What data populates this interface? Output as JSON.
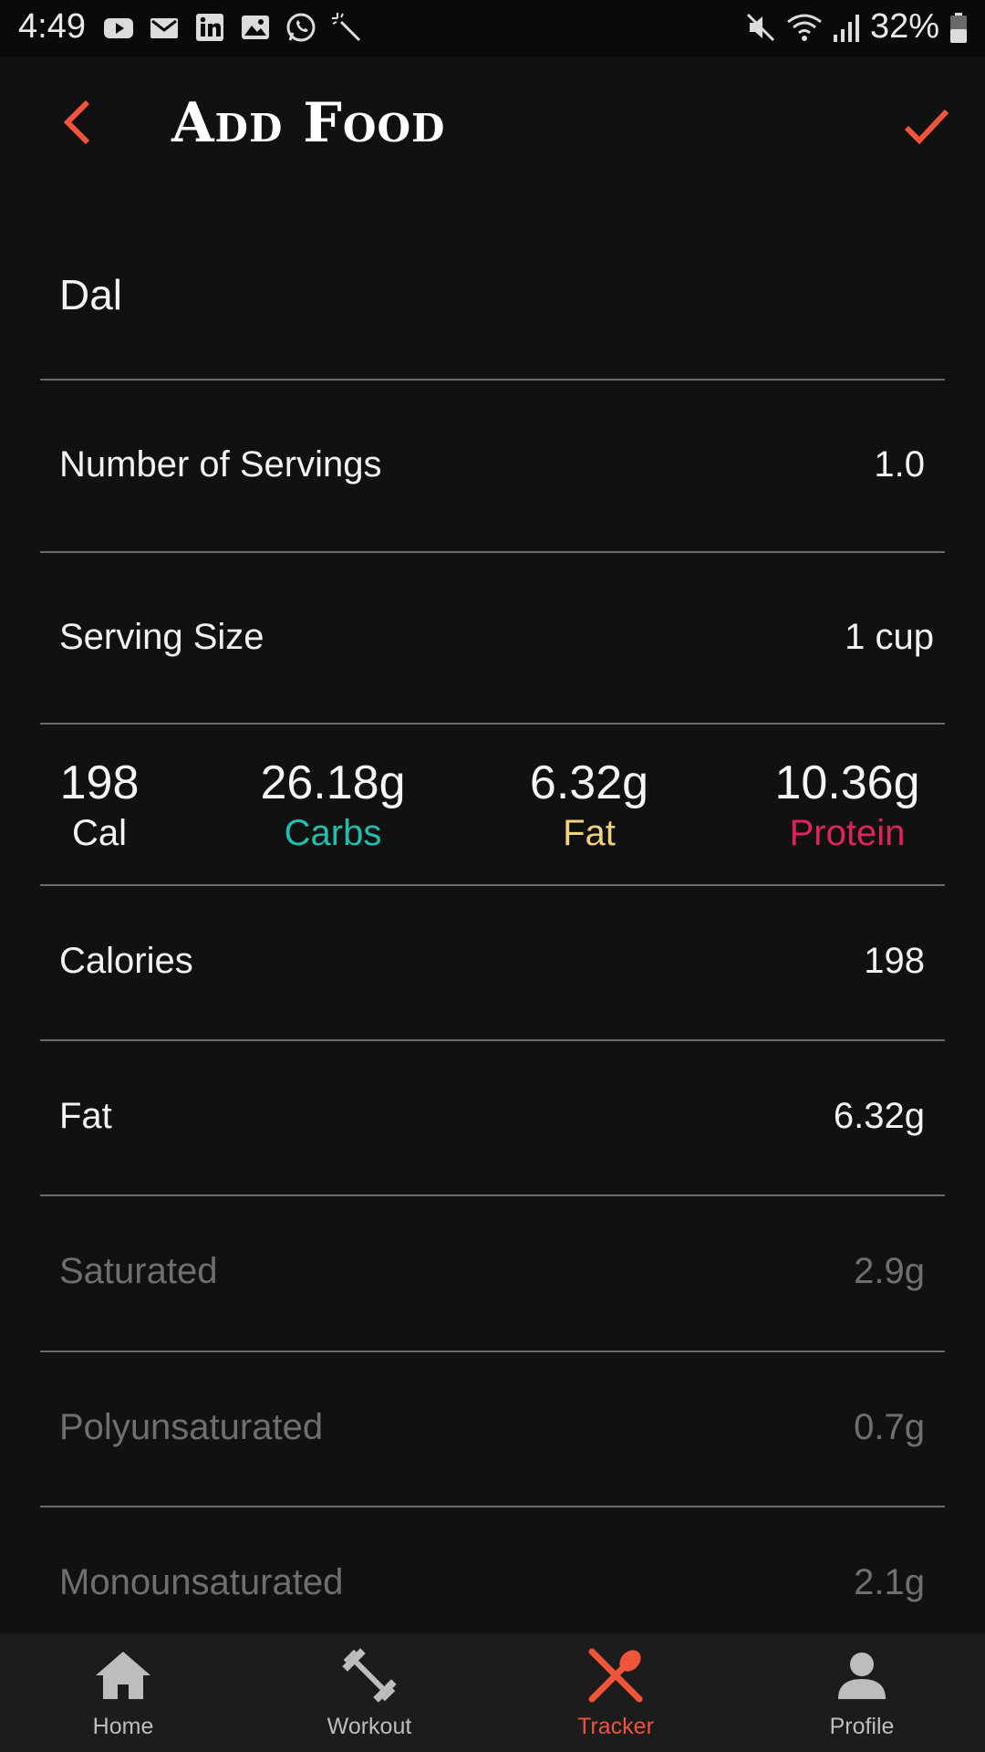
{
  "status_bar": {
    "time": "4:49",
    "battery": "32%"
  },
  "header": {
    "title": "Add Food"
  },
  "food": {
    "name": "Dal"
  },
  "servings": {
    "label": "Number of Servings",
    "value": "1.0"
  },
  "serving_size": {
    "label": "Serving Size",
    "value": "1 cup"
  },
  "macros": {
    "cal": {
      "value": "198",
      "label": "Cal"
    },
    "carbs": {
      "value": "26.18g",
      "label": "Carbs",
      "color": "#1fbfa9"
    },
    "fat": {
      "value": "6.32g",
      "label": "Fat",
      "color": "#f0d37a"
    },
    "protein": {
      "value": "10.36g",
      "label": "Protein",
      "color": "#e0245a"
    }
  },
  "nutrients": [
    {
      "label": "Calories",
      "value": "198"
    },
    {
      "label": "Fat",
      "value": "6.32g"
    },
    {
      "label": "Saturated",
      "value": "2.9g"
    },
    {
      "label": "Polyunsaturated",
      "value": "0.7g"
    },
    {
      "label": "Monounsaturated",
      "value": "2.1g"
    }
  ],
  "nav": [
    {
      "label": "Home",
      "icon": "home-icon"
    },
    {
      "label": "Workout",
      "icon": "dumbbell-icon"
    },
    {
      "label": "Tracker",
      "icon": "utensils-icon"
    },
    {
      "label": "Profile",
      "icon": "person-icon"
    }
  ],
  "colors": {
    "accent": "#f0543a",
    "background": "#111112"
  }
}
